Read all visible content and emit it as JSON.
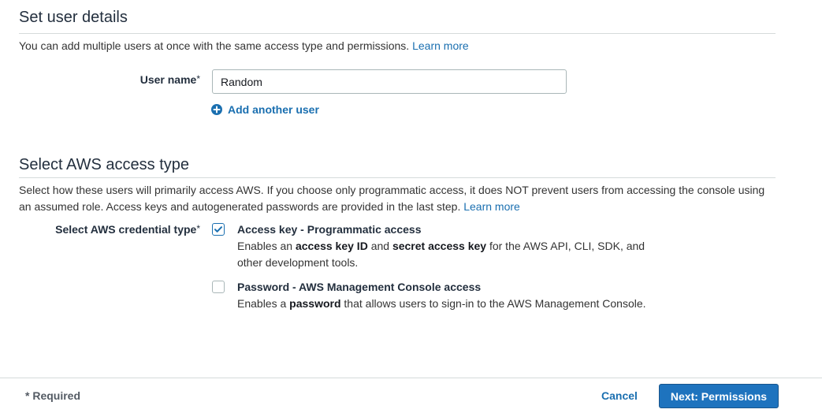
{
  "user_details": {
    "title": "Set user details",
    "description": "You can add multiple users at once with the same access type and permissions.",
    "learn_more": "Learn more",
    "user_name_label": "User name",
    "required_mark": "*",
    "user_name_value": "Random",
    "add_another_user": "Add another user"
  },
  "access_type": {
    "title": "Select AWS access type",
    "description": "Select how these users will primarily access AWS. If you choose only programmatic access, it does NOT prevent users from accessing the console using an assumed role. Access keys and autogenerated passwords are provided in the last step.",
    "learn_more": "Learn more",
    "credential_label": "Select AWS credential type",
    "required_mark": "*",
    "options": [
      {
        "title": "Access key - Programmatic access",
        "checked": true,
        "desc_1": "Enables an ",
        "desc_b1": "access key ID",
        "desc_2": " and ",
        "desc_b2": "secret access key",
        "desc_3": " for the AWS API, CLI, SDK, and other development tools."
      },
      {
        "title": "Password - AWS Management Console access",
        "checked": false,
        "desc_1": "Enables a ",
        "desc_b1": "password",
        "desc_2": " that allows users to sign-in to the AWS Management Console."
      }
    ]
  },
  "footer": {
    "required_note": "* Required",
    "cancel": "Cancel",
    "next": "Next: Permissions"
  }
}
